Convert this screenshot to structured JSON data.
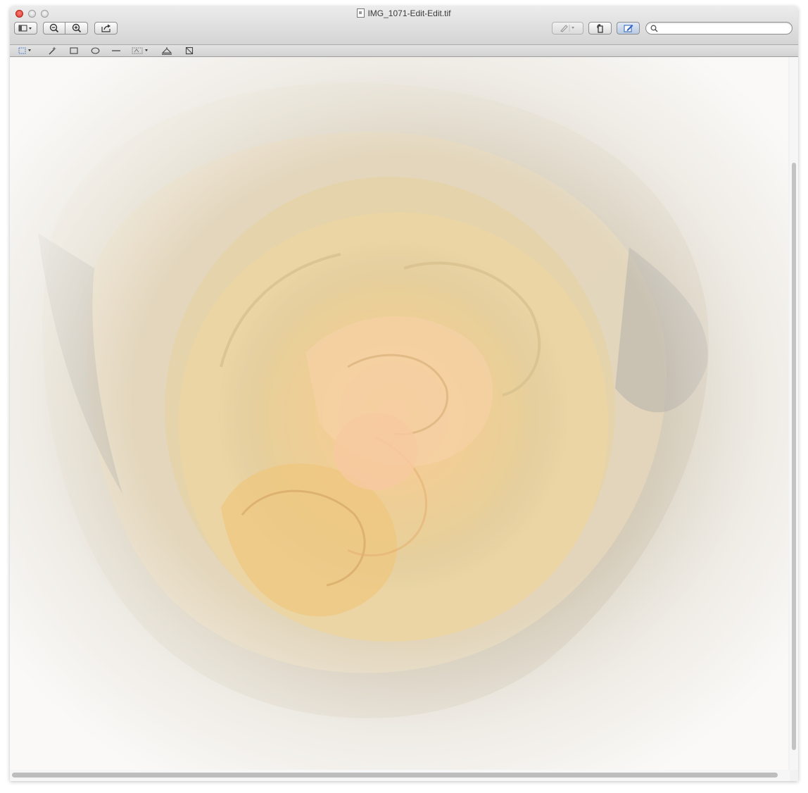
{
  "window": {
    "title": "IMG_1071-Edit-Edit.tif"
  },
  "toolbar": {
    "view_menu_icon": "sidebar-view-icon",
    "zoom_out_icon": "zoom-out-icon",
    "zoom_in_icon": "zoom-in-icon",
    "share_icon": "share-icon",
    "annotate_icon": "pen-icon",
    "rotate_icon": "rotate-icon",
    "edit_toolbar_icon": "edit-icon",
    "search": {
      "value": "",
      "placeholder": ""
    }
  },
  "edit_toolbar": {
    "tools": [
      "selection-icon",
      "instant-alpha-icon",
      "rectangle-icon",
      "oval-icon",
      "line-icon",
      "adjust-color-icon",
      "adjust-size-icon",
      "crop-icon"
    ]
  },
  "image": {
    "subject": "rose",
    "colors": {
      "petal_outer": "#e7e0d1",
      "petal_inner": "#f2cf8e",
      "center": "#f4b888",
      "vignette": "#f3f1ed"
    }
  }
}
